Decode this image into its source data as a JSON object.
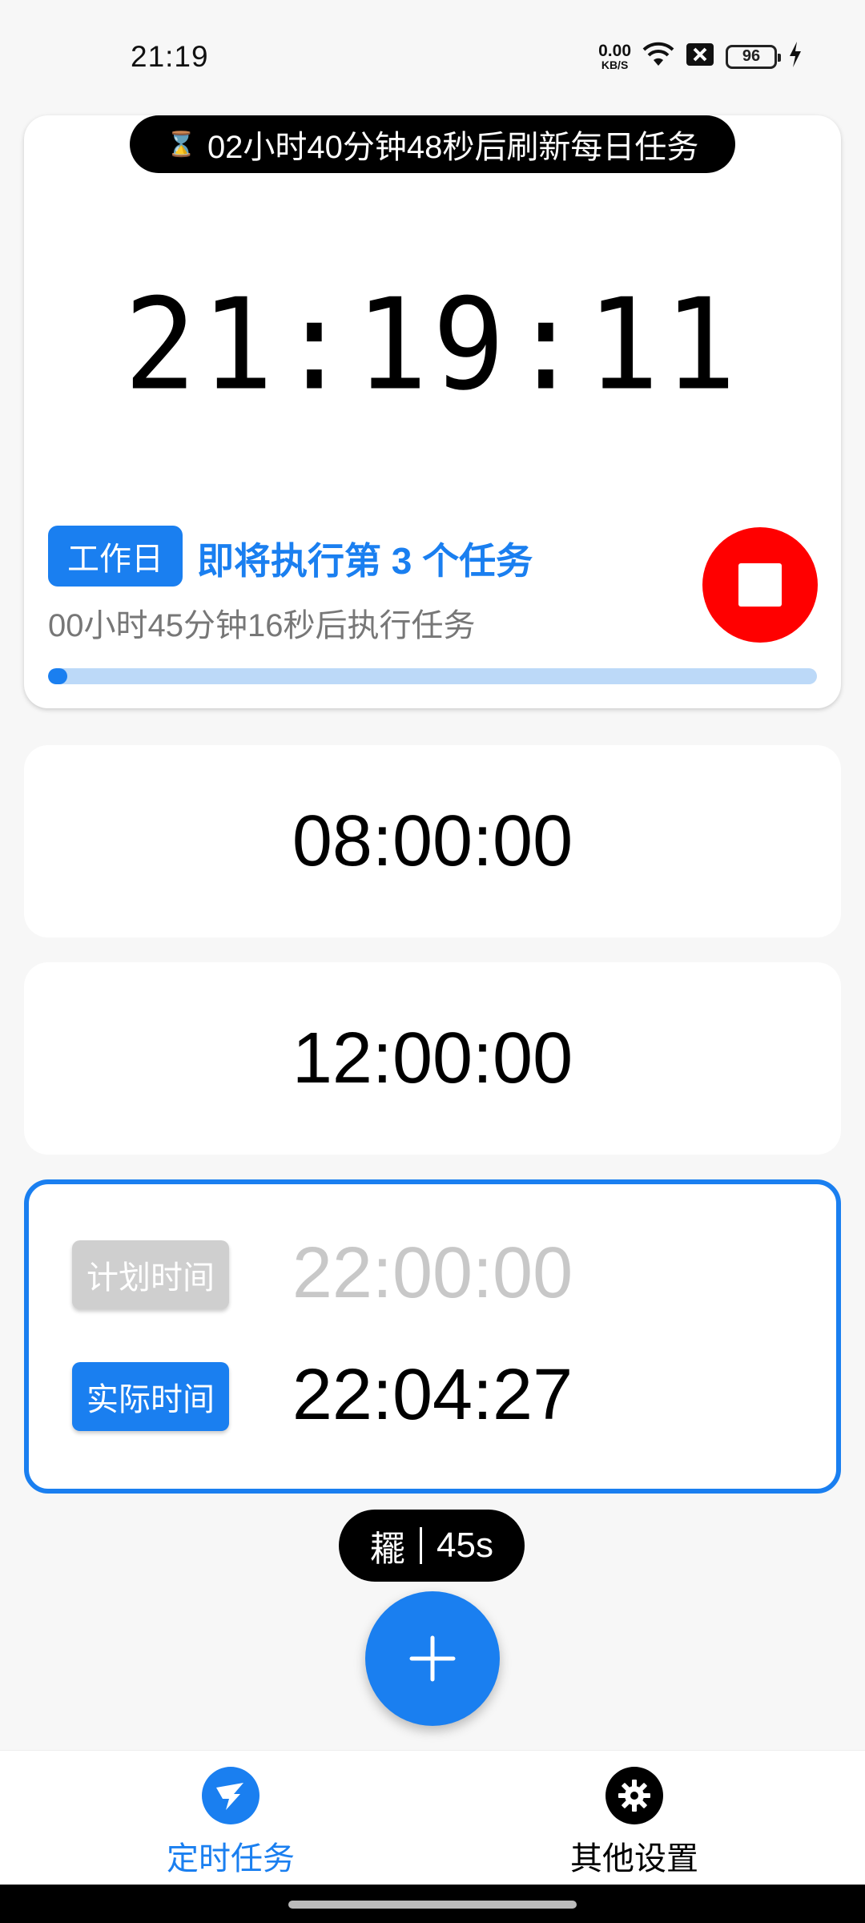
{
  "status_bar": {
    "time": "21:19",
    "net_speed_value": "0.00",
    "net_speed_unit": "KB/S",
    "battery": "96"
  },
  "top_card": {
    "refresh_text": "02小时40分钟48秒后刷新每日任务",
    "clock": "21:19:11",
    "workday_label": "工作日",
    "next_task_text": "即将执行第 3 个任务",
    "countdown_text": "00小时45分钟16秒后执行任务",
    "progress_fraction": 0.02
  },
  "tasks": [
    {
      "time": "08:00:00"
    },
    {
      "time": "12:00:00"
    }
  ],
  "active_task": {
    "plan_label": "计划时间",
    "plan_time": "22:00:00",
    "actual_label": "实际时间",
    "actual_time": "22:04:27"
  },
  "timer_pill": {
    "icon_glyph": "䎱",
    "value": "45s"
  },
  "bottom_nav": {
    "items": [
      {
        "label": "定时任务",
        "icon": "dingtalk-icon",
        "active": true
      },
      {
        "label": "其他设置",
        "icon": "gear-icon",
        "active": false
      }
    ]
  },
  "colors": {
    "accent": "#1a7ff0",
    "stop": "#ff0000",
    "progress_track": "#bcd9f8"
  }
}
